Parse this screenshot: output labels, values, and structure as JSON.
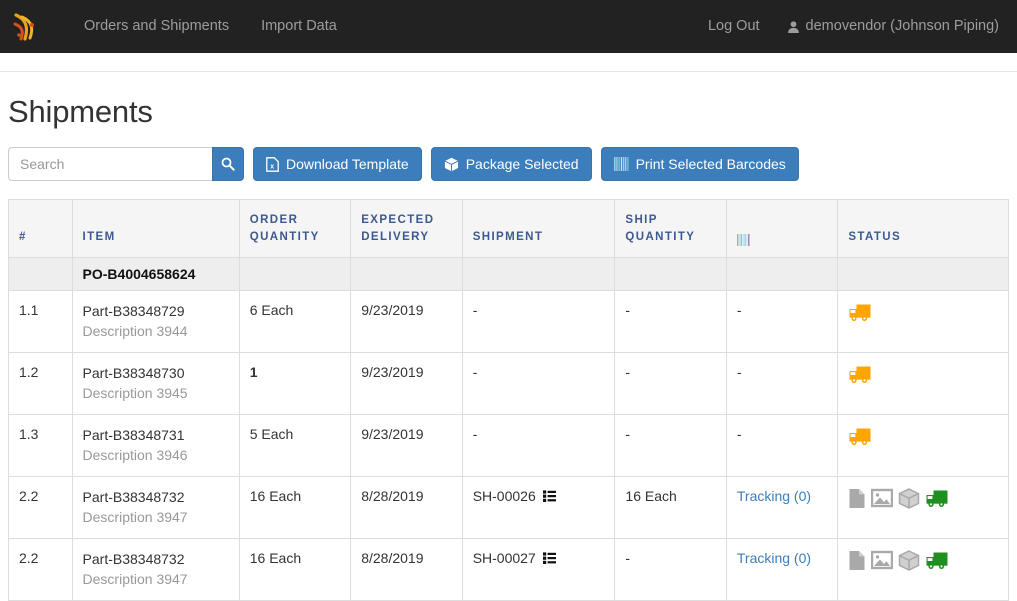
{
  "navbar": {
    "brand_icon": "signal-waves-logo",
    "left_links": [
      {
        "label": "Orders and Shipments",
        "name": "nav-orders-and-shipments"
      },
      {
        "label": "Import Data",
        "name": "nav-import-data"
      }
    ],
    "logout_label": "Log Out",
    "user_icon": "user-icon",
    "user_label": "demovendor (Johnson Piping)"
  },
  "page": {
    "title": "Shipments"
  },
  "search": {
    "value": "",
    "placeholder": "Search",
    "button_icon": "search-icon"
  },
  "toolbar": {
    "buttons": [
      {
        "label": "Download Template",
        "icon": "excel-file-icon",
        "name": "download-template-button"
      },
      {
        "label": "Package Selected",
        "icon": "cube-icon",
        "name": "package-selected-button"
      },
      {
        "label": "Print Selected Barcodes",
        "icon": "barcode-icon",
        "name": "print-selected-barcodes-button"
      }
    ]
  },
  "colors": {
    "navbar_bg": "#222222",
    "accent_blue": "#3c7dbc",
    "header_text": "#3c5a8f",
    "truck_pending": "#ffa500",
    "truck_shipped": "#1f8f1f",
    "icon_gray": "#a9a9a9"
  },
  "table": {
    "headers": [
      {
        "label": "#",
        "name": "col-header-number"
      },
      {
        "label": "Item",
        "name": "col-header-item"
      },
      {
        "label": "Order Quantity",
        "name": "col-header-order-quantity"
      },
      {
        "label": "Expected Delivery",
        "name": "col-header-expected-delivery"
      },
      {
        "label": "Shipment",
        "name": "col-header-shipment"
      },
      {
        "label": "Ship Quantity",
        "name": "col-header-ship-quantity"
      },
      {
        "label": "",
        "icon": "barcode-icon",
        "name": "col-header-barcode"
      },
      {
        "label": "Status",
        "name": "col-header-status"
      }
    ],
    "po_group": "PO-B4004658624",
    "rows": [
      {
        "number": "1.1",
        "part": "Part-B38348729",
        "description": "Description 3944",
        "order_quantity": "6 Each",
        "order_quantity_bold": false,
        "expected_delivery": "9/23/2019",
        "shipment": "-",
        "shipment_icon": null,
        "ship_quantity": "-",
        "barcode": "-",
        "barcode_link": false,
        "status_icons": [
          "truck-pending-icon"
        ]
      },
      {
        "number": "1.2",
        "part": "Part-B38348730",
        "description": "Description 3945",
        "order_quantity": "1",
        "order_quantity_bold": true,
        "expected_delivery": "9/23/2019",
        "shipment": "-",
        "shipment_icon": null,
        "ship_quantity": "-",
        "barcode": "-",
        "barcode_link": false,
        "status_icons": [
          "truck-pending-icon"
        ]
      },
      {
        "number": "1.3",
        "part": "Part-B38348731",
        "description": "Description 3946",
        "order_quantity": "5 Each",
        "order_quantity_bold": false,
        "expected_delivery": "9/23/2019",
        "shipment": "-",
        "shipment_icon": null,
        "ship_quantity": "-",
        "barcode": "-",
        "barcode_link": false,
        "status_icons": [
          "truck-pending-icon"
        ]
      },
      {
        "number": "2.2",
        "part": "Part-B38348732",
        "description": "Description 3947",
        "order_quantity": "16 Each",
        "order_quantity_bold": false,
        "expected_delivery": "8/28/2019",
        "shipment": "SH-00026",
        "shipment_icon": "list-icon",
        "ship_quantity": "16 Each",
        "barcode": "Tracking (0)",
        "barcode_link": true,
        "status_icons": [
          "file-icon",
          "image-icon",
          "cube-icon",
          "truck-shipped-icon"
        ]
      },
      {
        "number": "2.2",
        "part": "Part-B38348732",
        "description": "Description 3947",
        "order_quantity": "16 Each",
        "order_quantity_bold": false,
        "expected_delivery": "8/28/2019",
        "shipment": "SH-00027",
        "shipment_icon": "list-icon",
        "ship_quantity": "-",
        "barcode": "Tracking (0)",
        "barcode_link": true,
        "status_icons": [
          "file-icon",
          "image-icon",
          "cube-icon",
          "truck-shipped-icon"
        ]
      }
    ]
  }
}
